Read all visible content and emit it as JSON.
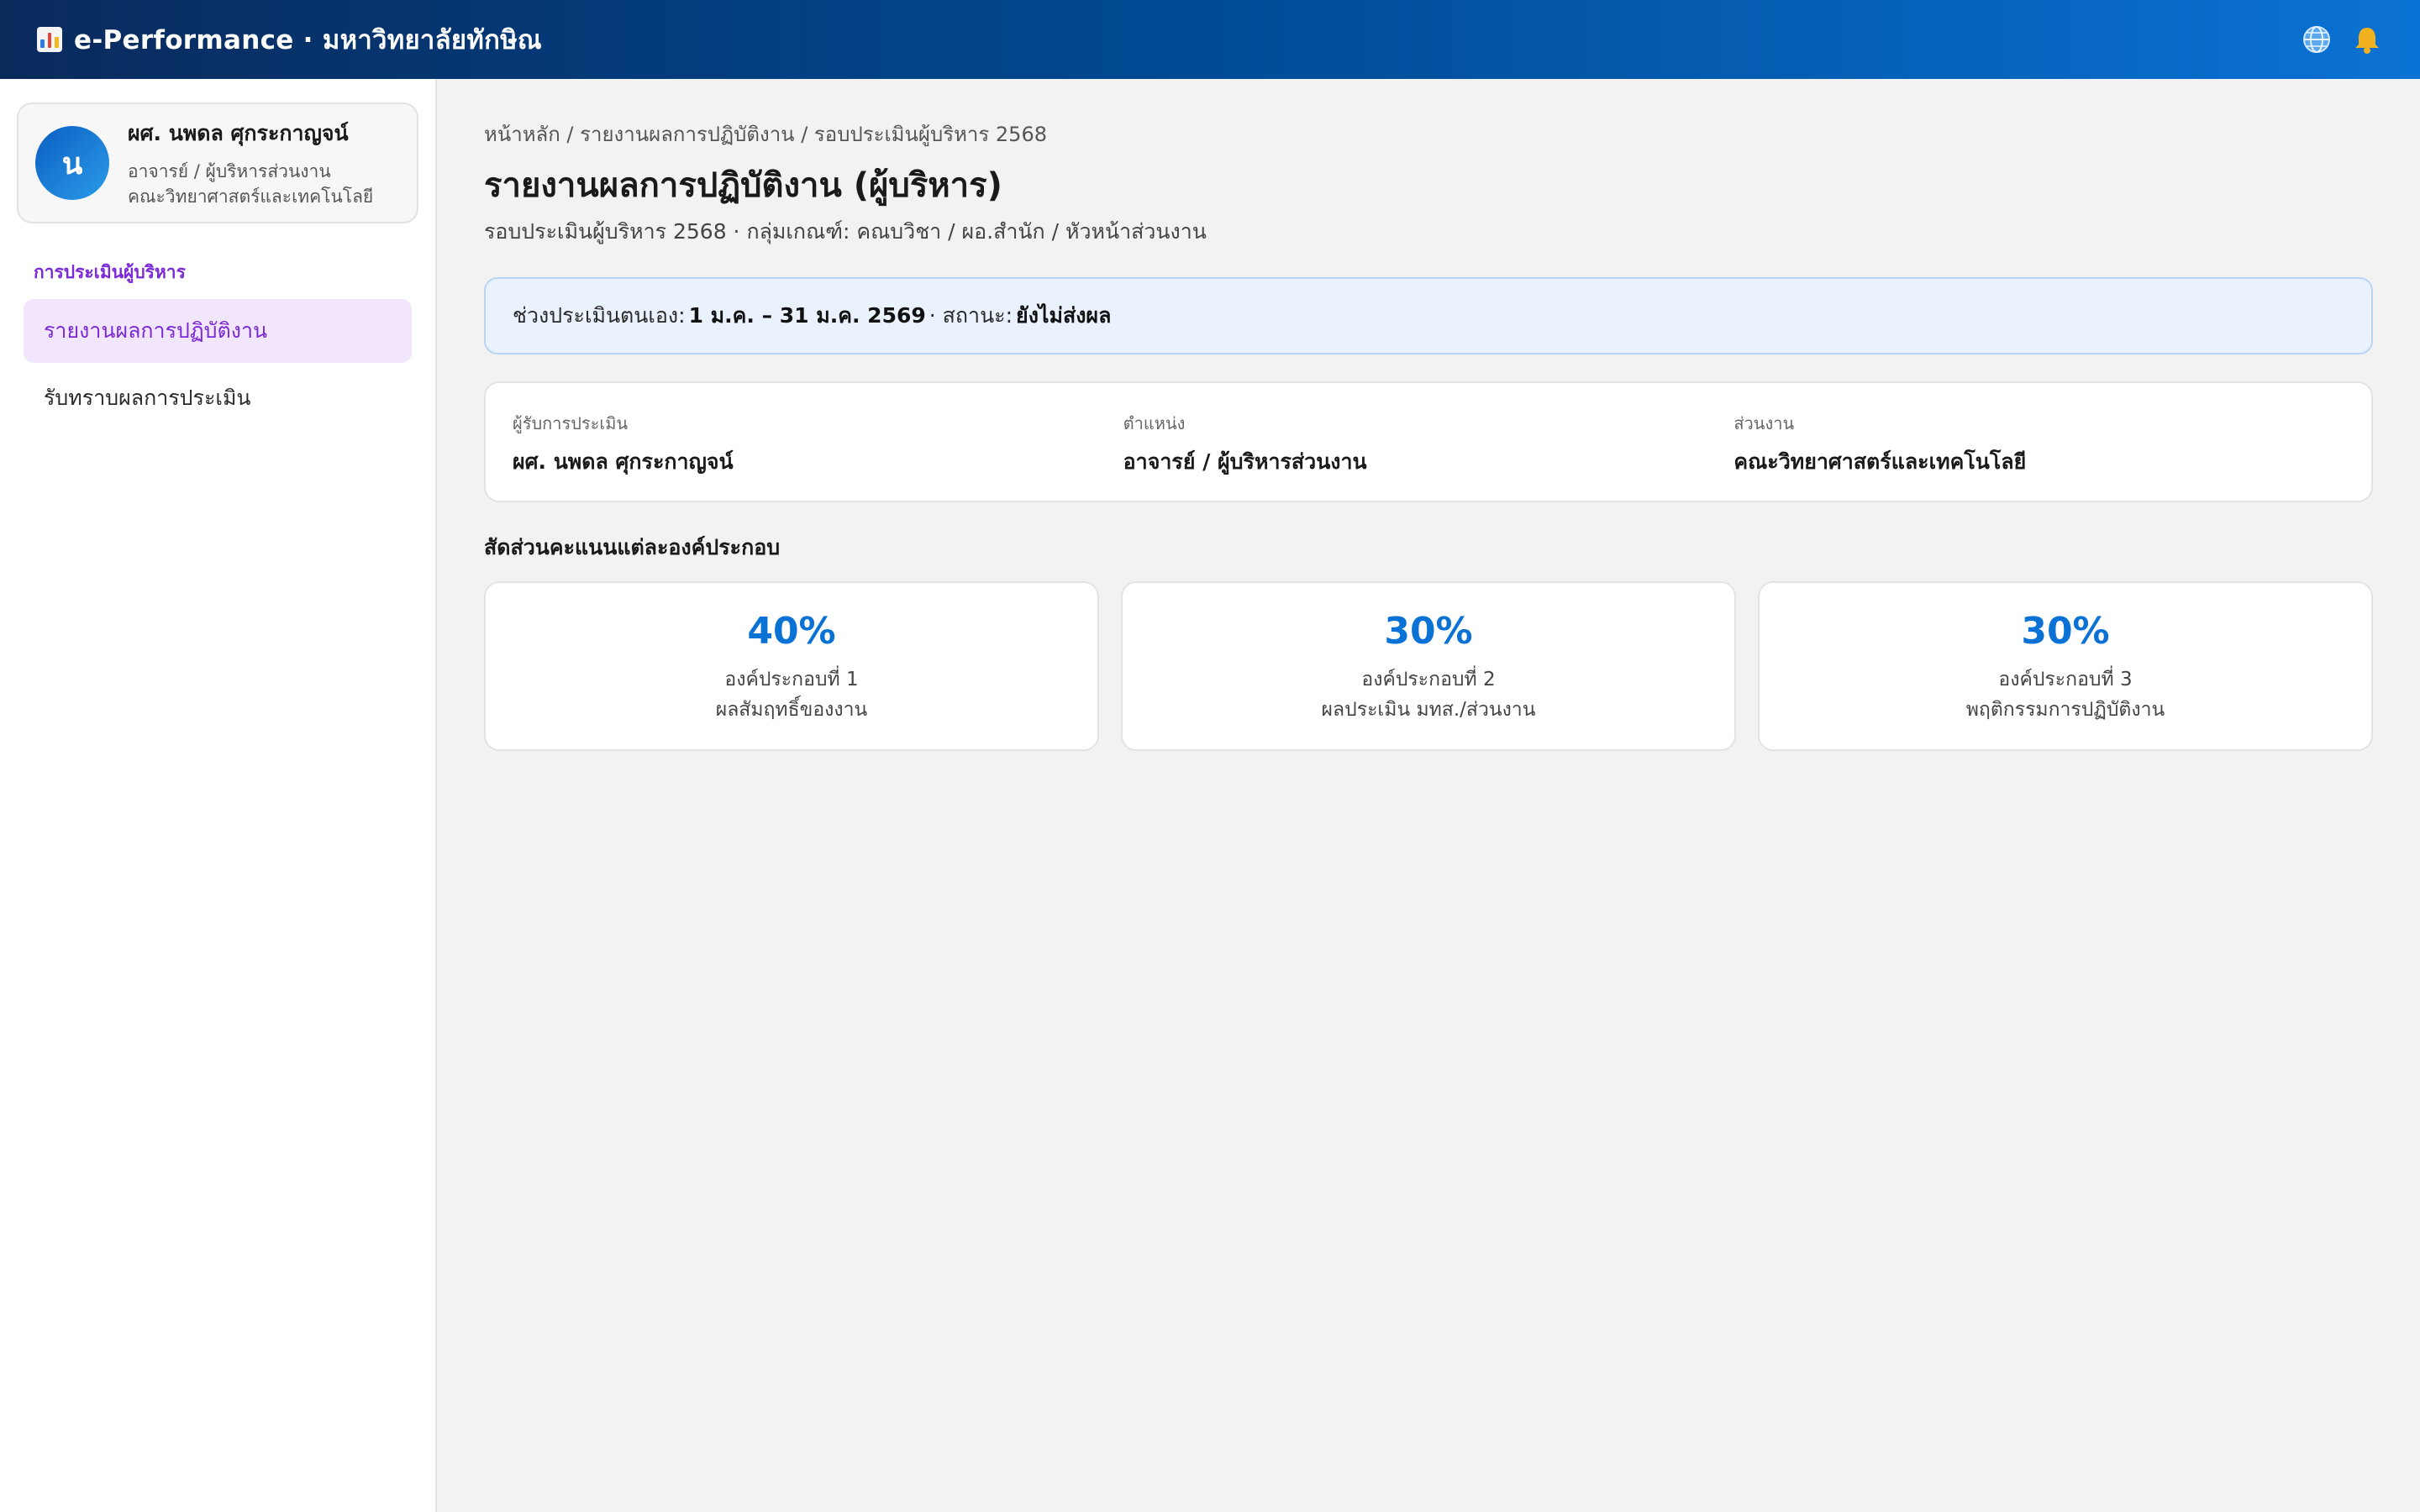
{
  "app": {
    "title": "e-Performance · มหาวิทยาลัยทักษิณ",
    "icons": {
      "brand": "bar-chart-icon",
      "language": "globe-icon",
      "notifications": "bell-icon"
    }
  },
  "user": {
    "avatar_initial": "น",
    "name": "ผศ. นพดล ศุกระกาญจน์",
    "position": "อาจารย์ / ผู้บริหารส่วนงาน",
    "unit": "คณะวิทยาศาสตร์และเทคโนโลยี"
  },
  "sidebar": {
    "section": "การประเมินผู้บริหาร",
    "items": [
      {
        "label": "รายงานผลการปฏิบัติงาน",
        "active": true
      },
      {
        "label": "รับทราบผลการประเมิน",
        "active": false
      }
    ]
  },
  "page": {
    "breadcrumb": "หน้าหลัก / รายงานผลการปฏิบัติงาน / รอบประเมินผู้บริหาร 2568",
    "title": "รายงานผลการปฏิบัติงาน (ผู้บริหาร)",
    "subtitle": "รอบประเมินผู้บริหาร 2568 · กลุ่มเกณฑ์: คณบวิชา / ผอ.สำนัก / หัวหน้าส่วนงาน"
  },
  "notice": {
    "prefix": "ช่วงประเมินตนเอง:",
    "period": "1 ม.ค. – 31 ม.ค. 2569",
    "status_label": "· สถานะ:",
    "status": "ยังไม่ส่งผล"
  },
  "info": [
    {
      "label": "ผู้รับการประเมิน",
      "value": "ผศ. นพดล ศุกระกาญจน์"
    },
    {
      "label": "ตำแหน่ง",
      "value": "อาจารย์ / ผู้บริหารส่วนงาน"
    },
    {
      "label": "ส่วนงาน",
      "value": "คณะวิทยาศาสตร์และเทคโนโลยี"
    }
  ],
  "weights": {
    "title": "สัดส่วนคะแนนแต่ละองค์ประกอบ",
    "items": [
      {
        "percent": "40%",
        "name": "องค์ประกอบที่ 1",
        "desc": "ผลสัมฤทธิ์ของงาน"
      },
      {
        "percent": "30%",
        "name": "องค์ประกอบที่ 2",
        "desc": "ผลประเมิน มทส./ส่วนงาน"
      },
      {
        "percent": "30%",
        "name": "องค์ประกอบที่ 3",
        "desc": "พฤติกรรมการปฏิบัติงาน"
      }
    ]
  },
  "colors": {
    "accent": "#0a72d4",
    "sidebar_active": "#7a2ad6",
    "topbar_start": "#0a2a5c",
    "topbar_end": "#0a72d4"
  }
}
